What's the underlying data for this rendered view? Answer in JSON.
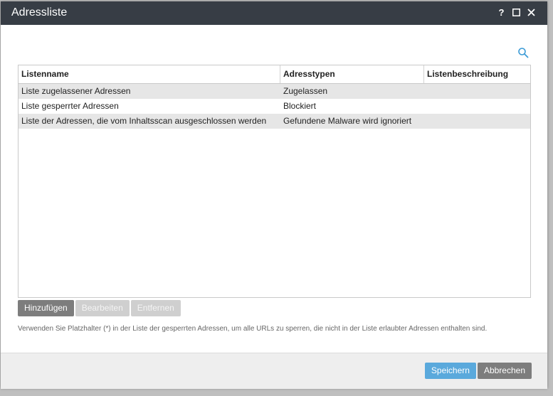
{
  "window": {
    "title": "Adressliste",
    "help_glyph": "?",
    "maximize_glyph": "☐",
    "close_glyph": "✕"
  },
  "search": {
    "icon": "search-icon",
    "color": "#3c9bd6"
  },
  "table": {
    "columns": [
      "Listenname",
      "Adresstypen",
      "Listenbeschreibung"
    ],
    "rows": [
      {
        "name": "Liste zugelassener Adressen",
        "type": "Zugelassen",
        "description": ""
      },
      {
        "name": "Liste gesperrter Adressen",
        "type": "Blockiert",
        "description": ""
      },
      {
        "name": "Liste der Adressen, die vom Inhaltsscan ausgeschlossen werden",
        "type": "Gefundene Malware wird ignoriert",
        "description": ""
      }
    ]
  },
  "actions": {
    "add_label": "Hinzufügen",
    "edit_label": "Bearbeiten",
    "remove_label": "Entfernen"
  },
  "hint": "Verwenden Sie Platzhalter (*) in der Liste der gesperrten Adressen, um alle URLs zu sperren, die nicht in der Liste erlaubter Adressen enthalten sind.",
  "footer": {
    "save_label": "Speichern",
    "cancel_label": "Abbrechen"
  },
  "colors": {
    "titlebar": "#373d45",
    "primary_button": "#5aa9dc",
    "secondary_button": "#7d7d7d",
    "row_alt": "#e6e6e6"
  }
}
